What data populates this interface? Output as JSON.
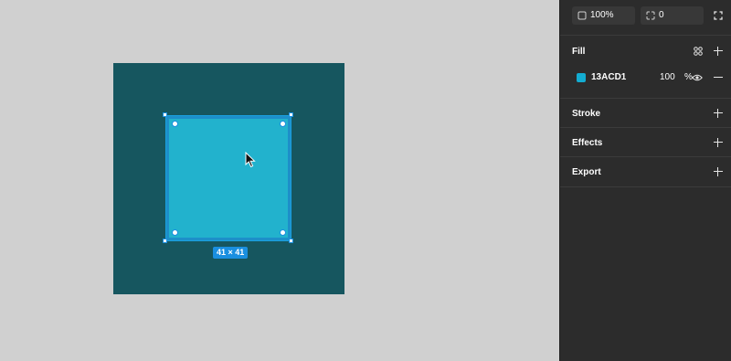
{
  "canvas": {
    "size_label": "41 × 41",
    "shape_color": "#22b2cd",
    "frame_color": "#16565f"
  },
  "panel": {
    "opacity_field": {
      "value": "100%",
      "icon": "opacity-icon"
    },
    "radius_field": {
      "value": "0",
      "icon": "corner-radius-icon"
    },
    "fill": {
      "title": "Fill",
      "hex": "13ACD1",
      "swatch_color": "#13ACD1",
      "opacity": "100",
      "percent_sign": "%"
    },
    "stroke": {
      "title": "Stroke"
    },
    "effects": {
      "title": "Effects"
    },
    "export": {
      "title": "Export"
    }
  }
}
